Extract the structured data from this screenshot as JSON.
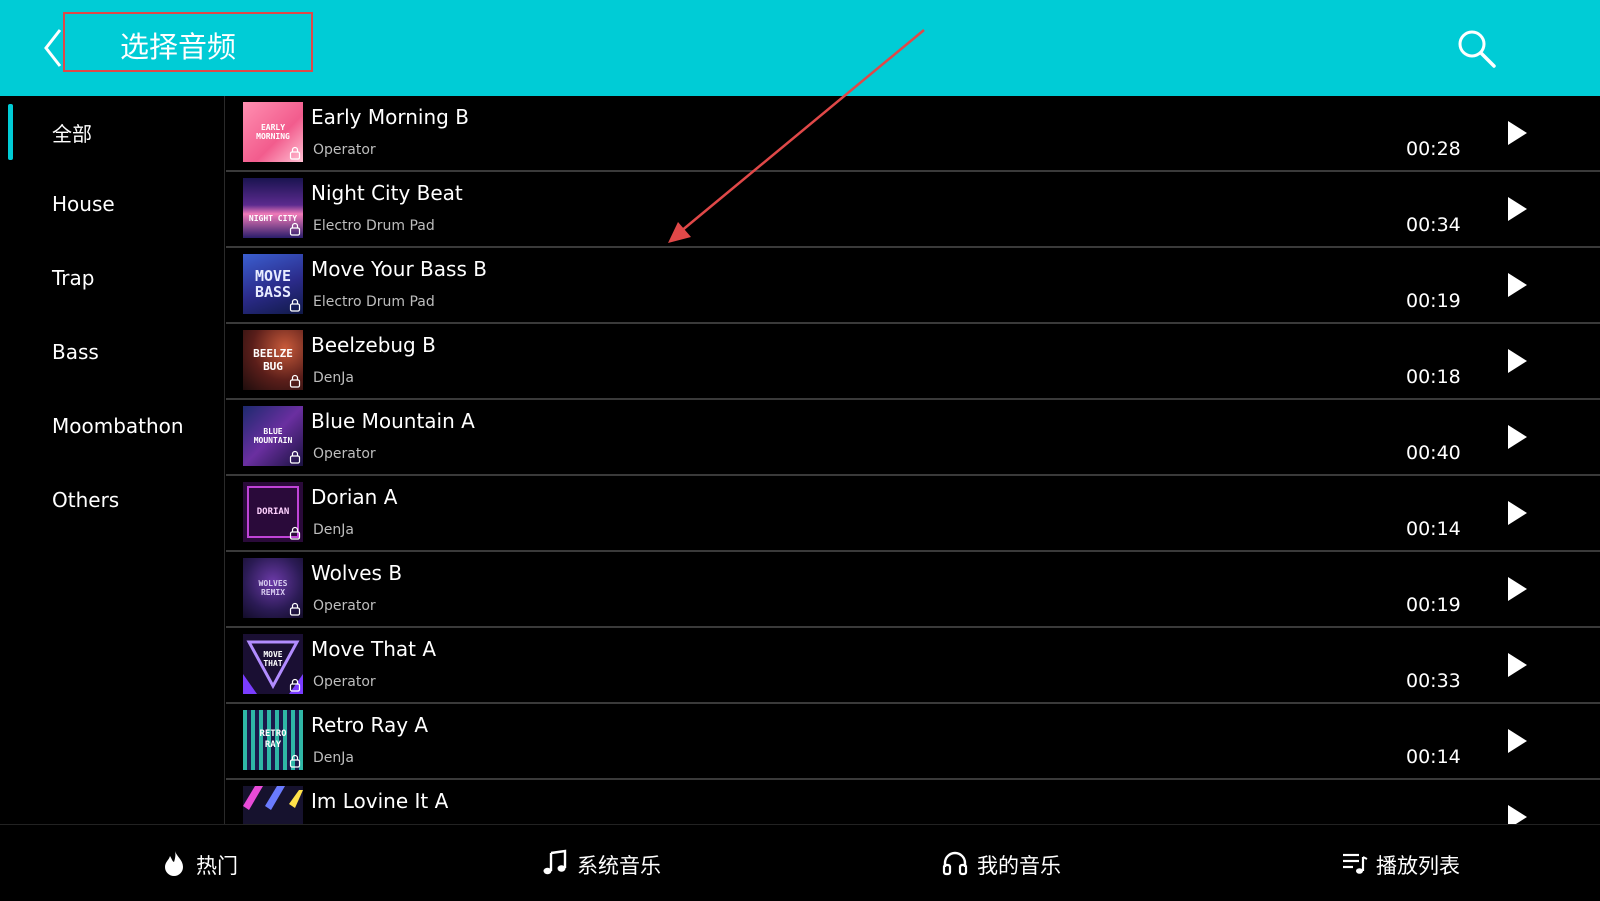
{
  "header": {
    "title": "选择音频"
  },
  "categories": [
    {
      "label": "全部",
      "active": true
    },
    {
      "label": "House"
    },
    {
      "label": "Trap"
    },
    {
      "label": "Bass"
    },
    {
      "label": "Moombathon"
    },
    {
      "label": "Others"
    }
  ],
  "tracks": [
    {
      "title": "Early Morning B",
      "artist": "Operator",
      "duration": "00:28",
      "cover_text": "EARLY\nMORNING"
    },
    {
      "title": "Night City Beat",
      "artist": "Electro Drum Pad",
      "duration": "00:34",
      "cover_text": "NIGHT CITY"
    },
    {
      "title": "Move Your Bass B",
      "artist": "Electro Drum Pad",
      "duration": "00:19",
      "cover_text": "MOVE\nBASS"
    },
    {
      "title": "Beelzebug B",
      "artist": "DenJa",
      "duration": "00:18",
      "cover_text": "BEELZE\nBUG"
    },
    {
      "title": "Blue Mountain A",
      "artist": "Operator",
      "duration": "00:40",
      "cover_text": "BLUE\nMOUNTAIN"
    },
    {
      "title": "Dorian A",
      "artist": "DenJa",
      "duration": "00:14",
      "cover_text": "DORIAN"
    },
    {
      "title": "Wolves B",
      "artist": "Operator",
      "duration": "00:19",
      "cover_text": "WOLVES\nREMIX"
    },
    {
      "title": "Move That A",
      "artist": "Operator",
      "duration": "00:33",
      "cover_text": "MOVE\nTHAT"
    },
    {
      "title": "Retro Ray A",
      "artist": "DenJa",
      "duration": "00:14",
      "cover_text": "RETRO\nRAY"
    },
    {
      "title": "Im Lovine It A",
      "artist": "",
      "duration": "",
      "cover_text": ""
    }
  ],
  "bottom_tabs": [
    {
      "label": "热门",
      "icon": "flame-icon"
    },
    {
      "label": "系统音乐",
      "icon": "music-note-icon"
    },
    {
      "label": "我的音乐",
      "icon": "headphones-icon"
    },
    {
      "label": "播放列表",
      "icon": "playlist-icon"
    }
  ],
  "colors": {
    "accent": "#00ccd6",
    "annotation": "#e04848",
    "background": "#000000"
  },
  "icons": {
    "back": "chevron-left-icon",
    "search": "search-icon",
    "play": "play-icon",
    "lock": "lock-icon"
  }
}
